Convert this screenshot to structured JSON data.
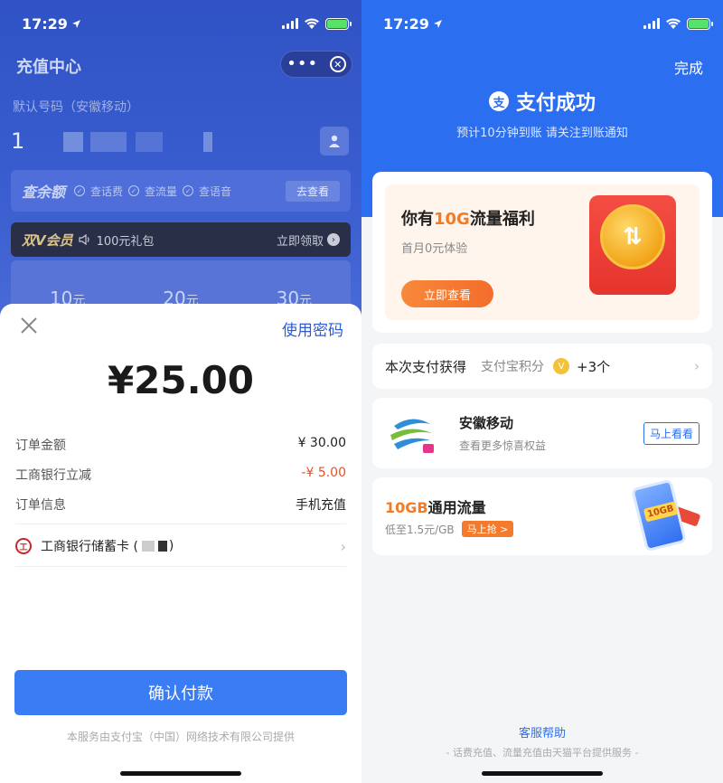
{
  "left": {
    "status": {
      "time": "17:29"
    },
    "page_title": "充值中心",
    "capsule": {
      "more": "•••",
      "close": "⊗"
    },
    "default_number_label": "默认号码（安徽移动）",
    "phone_number_prefix": "1",
    "balance": {
      "title": "查余额",
      "items": [
        "查话费",
        "查流量",
        "查语音"
      ],
      "button": "去查看"
    },
    "vip": {
      "title": "双V会员",
      "gift": "100元礼包",
      "claim": "立即领取"
    },
    "amounts": [
      {
        "value": "10",
        "unit": "元"
      },
      {
        "value": "20",
        "unit": "元"
      },
      {
        "value": "30",
        "unit": "元"
      }
    ],
    "sheet": {
      "use_password": "使用密码",
      "price": "¥25.00",
      "rows": [
        {
          "label": "订单金额",
          "value": "¥ 30.00"
        },
        {
          "label": "工商银行立减",
          "value": "-¥ 5.00"
        },
        {
          "label": "订单信息",
          "value": "手机充值"
        }
      ],
      "bank_card": "工商银行储蓄卡 (",
      "bank_card_tail": ")",
      "confirm_button": "确认付款",
      "provider": "本服务由支付宝（中国）网络技术有限公司提供"
    }
  },
  "right": {
    "status": {
      "time": "17:29"
    },
    "done": "完成",
    "success_title": "支付成功",
    "success_sub": "预计10分钟到账 请关注到账通知",
    "promo": {
      "head_pre": "你有",
      "head_hl": "10G",
      "head_post": "流量福利",
      "sub": "首月0元体验",
      "cta": "立即查看"
    },
    "points": {
      "title": "本次支付获得",
      "label": "支付宝积分",
      "count": "+3个"
    },
    "mobile": {
      "name": "安徽移动",
      "desc": "查看更多惊喜权益",
      "button": "马上看看"
    },
    "flow": {
      "title_hl": "10GB",
      "title_post": "通用流量",
      "price": "低至1.5元/GB",
      "tag": "马上抢 >",
      "badge": "10GB"
    },
    "help": "客服帮助",
    "footer": "- 话费充值、流量充值由天猫平台提供服务 -"
  },
  "colors": {
    "alipay_blue": "#2c6ef0",
    "pay_button": "#3a7cf4",
    "accent_orange": "#f47a23",
    "discount_red": "#e2532b"
  }
}
